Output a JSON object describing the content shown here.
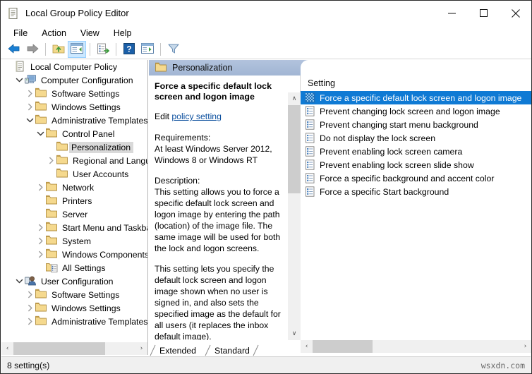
{
  "window": {
    "title": "Local Group Policy Editor",
    "icon": "policy-document-icon",
    "minimize": "–",
    "maximize": "☐",
    "close": "✕"
  },
  "menubar": {
    "items": [
      {
        "label": "File",
        "name": "menu-file"
      },
      {
        "label": "Action",
        "name": "menu-action"
      },
      {
        "label": "View",
        "name": "menu-view"
      },
      {
        "label": "Help",
        "name": "menu-help"
      }
    ]
  },
  "toolbar": {
    "buttons": [
      {
        "name": "back-icon",
        "title": "Back"
      },
      {
        "name": "forward-icon",
        "title": "Forward"
      },
      {
        "name": "up-one-level-icon",
        "title": "Up One Level"
      },
      {
        "name": "show-hide-console-tree-icon",
        "title": "Show/Hide Console Tree",
        "active": true
      },
      {
        "name": "export-list-icon",
        "title": "Export List"
      },
      {
        "name": "help-icon",
        "title": "Help"
      },
      {
        "name": "properties-icon",
        "title": "Properties"
      },
      {
        "name": "filter-icon",
        "title": "Filter"
      }
    ]
  },
  "tree": {
    "items": [
      {
        "label": "Local Computer Policy",
        "indent": 0,
        "twisty": "",
        "icon": "policy-document-icon",
        "selected": false
      },
      {
        "label": "Computer Configuration",
        "indent": 1,
        "twisty": "expanded",
        "icon": "computer-icon",
        "selected": false
      },
      {
        "label": "Software Settings",
        "indent": 2,
        "twisty": "collapsed",
        "icon": "folder-icon",
        "selected": false
      },
      {
        "label": "Windows Settings",
        "indent": 2,
        "twisty": "collapsed",
        "icon": "folder-icon",
        "selected": false
      },
      {
        "label": "Administrative Templates",
        "indent": 2,
        "twisty": "expanded",
        "icon": "folder-icon",
        "selected": false
      },
      {
        "label": "Control Panel",
        "indent": 3,
        "twisty": "expanded",
        "icon": "folder-icon",
        "selected": false
      },
      {
        "label": "Personalization",
        "indent": 4,
        "twisty": "",
        "icon": "folder-icon",
        "selected": true
      },
      {
        "label": "Regional and Langu",
        "indent": 4,
        "twisty": "collapsed",
        "icon": "folder-icon",
        "selected": false
      },
      {
        "label": "User Accounts",
        "indent": 4,
        "twisty": "",
        "icon": "folder-icon",
        "selected": false
      },
      {
        "label": "Network",
        "indent": 3,
        "twisty": "collapsed",
        "icon": "folder-icon",
        "selected": false
      },
      {
        "label": "Printers",
        "indent": 3,
        "twisty": "",
        "icon": "folder-icon",
        "selected": false
      },
      {
        "label": "Server",
        "indent": 3,
        "twisty": "",
        "icon": "folder-icon",
        "selected": false
      },
      {
        "label": "Start Menu and Taskba",
        "indent": 3,
        "twisty": "collapsed",
        "icon": "folder-icon",
        "selected": false
      },
      {
        "label": "System",
        "indent": 3,
        "twisty": "collapsed",
        "icon": "folder-icon",
        "selected": false
      },
      {
        "label": "Windows Components",
        "indent": 3,
        "twisty": "collapsed",
        "icon": "folder-icon",
        "selected": false
      },
      {
        "label": "All Settings",
        "indent": 3,
        "twisty": "",
        "icon": "all-settings-icon",
        "selected": false
      },
      {
        "label": "User Configuration",
        "indent": 1,
        "twisty": "expanded",
        "icon": "user-icon",
        "selected": false
      },
      {
        "label": "Software Settings",
        "indent": 2,
        "twisty": "collapsed",
        "icon": "folder-icon",
        "selected": false
      },
      {
        "label": "Windows Settings",
        "indent": 2,
        "twisty": "collapsed",
        "icon": "folder-icon",
        "selected": false
      },
      {
        "label": "Administrative Templates",
        "indent": 2,
        "twisty": "collapsed",
        "icon": "folder-icon",
        "selected": false
      }
    ],
    "hscroll": {
      "left_arrow": "‹",
      "right_arrow": "›"
    }
  },
  "folder_header": {
    "label": "Personalization",
    "icon": "folder-icon"
  },
  "detail": {
    "title": "Force a specific default lock screen and logon image",
    "edit_prefix": "Edit ",
    "edit_link": "policy setting",
    "requirements_label": "Requirements:",
    "requirements_text": "At least Windows Server 2012, Windows 8 or Windows RT",
    "description_label": "Description:",
    "description_p1": "This setting allows you to force a specific default lock screen and logon image by entering the path (location) of the image file. The same image will be used for both the lock and logon screens.",
    "description_p2": "This setting lets you specify the default lock screen and logon image shown when no user is signed in, and also sets the specified image as the default for all users (it replaces the inbox default image).",
    "scroll_up": "∧",
    "scroll_down": "∨"
  },
  "list": {
    "column_header": "Setting",
    "rows": [
      {
        "label": "Force a specific default lock screen and logon image",
        "selected": true,
        "icon": "policy-setting-icon"
      },
      {
        "label": "Prevent changing lock screen and logon image",
        "selected": false,
        "icon": "policy-setting-icon"
      },
      {
        "label": "Prevent changing start menu background",
        "selected": false,
        "icon": "policy-setting-icon"
      },
      {
        "label": "Do not display the lock screen",
        "selected": false,
        "icon": "policy-setting-icon"
      },
      {
        "label": "Prevent enabling lock screen camera",
        "selected": false,
        "icon": "policy-setting-icon"
      },
      {
        "label": "Prevent enabling lock screen slide show",
        "selected": false,
        "icon": "policy-setting-icon"
      },
      {
        "label": "Force a specific background and accent color",
        "selected": false,
        "icon": "policy-setting-icon"
      },
      {
        "label": "Force a specific Start background",
        "selected": false,
        "icon": "policy-setting-icon"
      }
    ],
    "hscroll": {
      "left_arrow": "‹",
      "right_arrow": "›"
    }
  },
  "tabs": [
    {
      "label": "Extended",
      "active": false
    },
    {
      "label": "Standard",
      "active": true
    }
  ],
  "statusbar": {
    "text": "8 setting(s)",
    "watermark": "wsxdn.com"
  },
  "colors": {
    "selection_blue": "#0f7ad4",
    "header_band": "#a9bcd8",
    "link": "#0b4f9e",
    "tree_selected_bg": "#d9d9d9"
  }
}
